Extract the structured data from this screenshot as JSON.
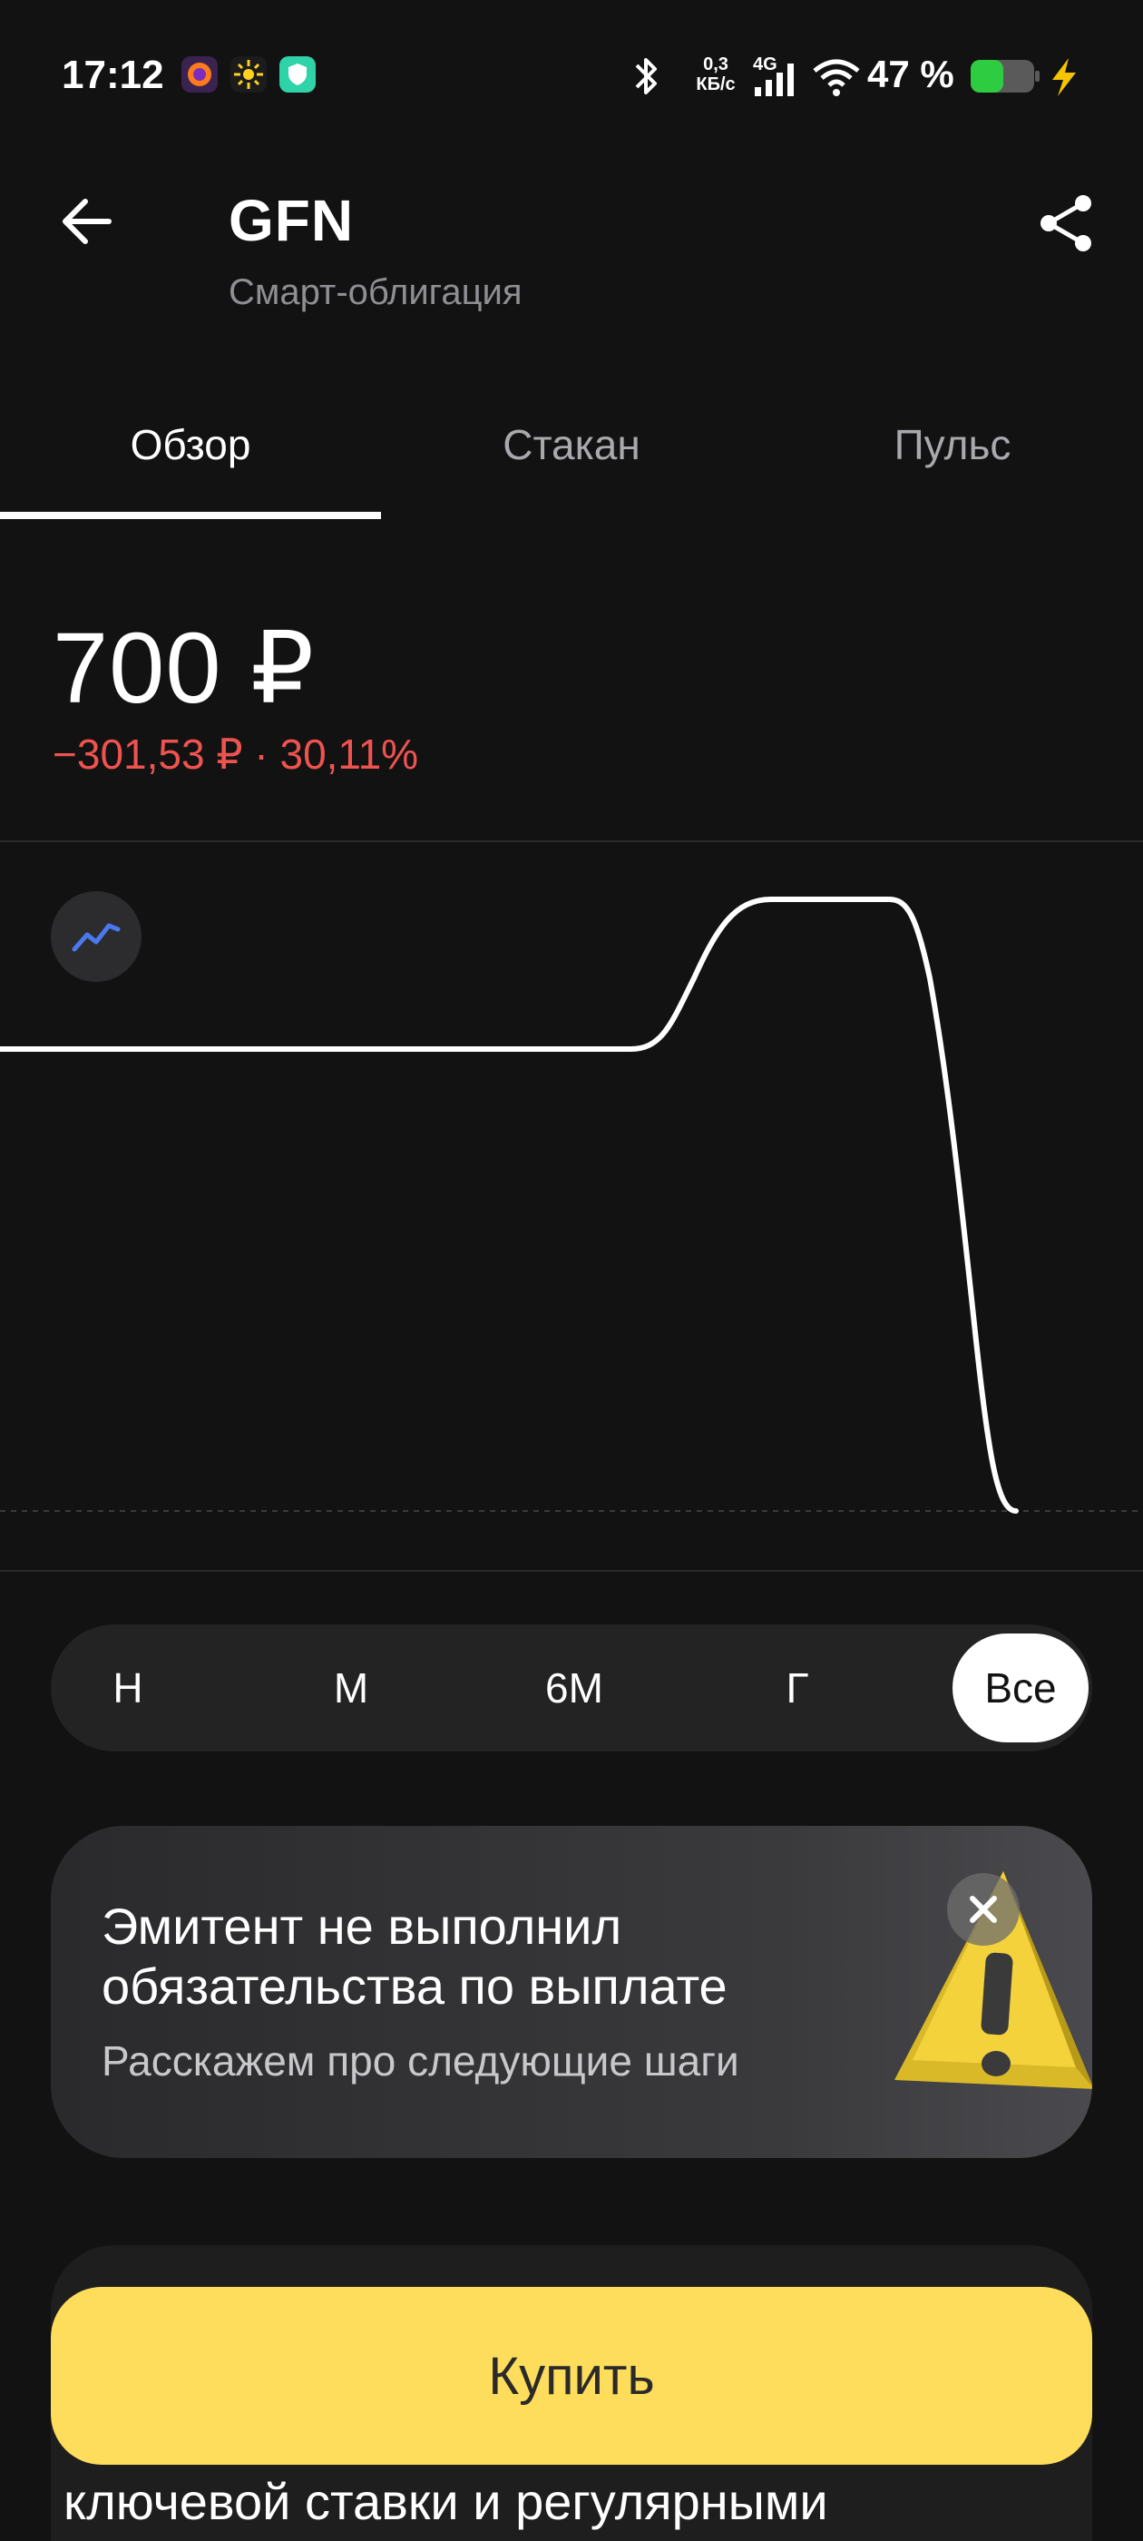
{
  "status_bar": {
    "time": "17:12",
    "speed_value": "0,3",
    "speed_unit": "КБ/с",
    "network": "4G",
    "battery_pct": "47 %",
    "icons": [
      "firefox-icon",
      "sun-app-icon",
      "shield-app-icon",
      "bluetooth-icon",
      "signal-icon",
      "wifi-icon",
      "battery-icon",
      "charging-icon"
    ]
  },
  "header": {
    "title": "GFN",
    "subtitle": "Смарт-облигация"
  },
  "tabs": [
    {
      "label": "Обзор",
      "active": true
    },
    {
      "label": "Стакан",
      "active": false
    },
    {
      "label": "Пульс",
      "active": false
    }
  ],
  "price": {
    "value": "700 ₽",
    "change": "−301,53 ₽ · 30,11%",
    "change_color": "#ef5350"
  },
  "periods": [
    {
      "label": "Н",
      "active": false
    },
    {
      "label": "М",
      "active": false
    },
    {
      "label": "6М",
      "active": false
    },
    {
      "label": "Г",
      "active": false
    },
    {
      "label": "Все",
      "active": true
    }
  ],
  "alert": {
    "title": "Эмитент не выполнил обязательства по выплате",
    "subtitle": "Расскажем про следующие шаги"
  },
  "bottom_card": {
    "text": "ключевой ставки и регулярными"
  },
  "buy_button": {
    "label": "Купить",
    "color": "#fddd5b"
  },
  "colors": {
    "background": "#121212",
    "accent": "#fddd5b",
    "negative": "#ef5350"
  }
}
